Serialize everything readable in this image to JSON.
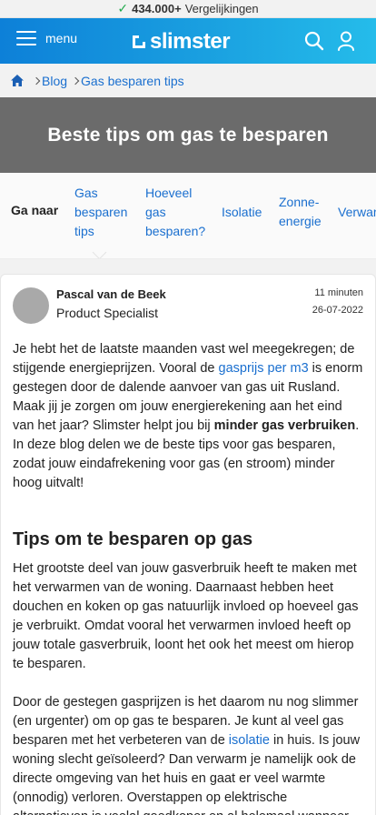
{
  "topbar": {
    "count": "434.000+",
    "label": "Vergelijkingen",
    "icon": "check-icon"
  },
  "header": {
    "menu_label": "menu",
    "logo_text": "slimster",
    "search_icon": "search-icon",
    "user_icon": "user-icon"
  },
  "breadcrumb": {
    "home_icon": "home-icon",
    "items": [
      "Blog",
      "Gas besparen tips"
    ]
  },
  "hero": {
    "title": "Beste tips om gas te besparen"
  },
  "jumpnav": {
    "label": "Ga naar",
    "items": [
      {
        "line1": "Gas",
        "line2": "besparen",
        "line3": "tips"
      },
      {
        "line1": "Hoeveel",
        "line2": "gas",
        "line3": "besparen?"
      },
      {
        "line1": "Isolatie"
      },
      {
        "line1": "Zonne-",
        "line2": "energie"
      },
      {
        "line1": "Verwarmen"
      }
    ]
  },
  "author": {
    "name": "Pascal van de Beek",
    "role": "Product Specialist",
    "read_time": "11 minuten",
    "date": "26-07-2022"
  },
  "intro": {
    "t1": "Je hebt het de laatste maanden vast wel meegekregen; de stijgende energieprijzen. Vooral de ",
    "link1": "gasprijs per m3",
    "t2": " is enorm gestegen door de dalende aanvoer van gas uit Rusland. Maak jij je zorgen om jouw energierekening aan het eind van het jaar? Slimster helpt jou bij ",
    "bold1": "minder gas verbruiken",
    "t3": ". In deze blog delen we de beste tips voor gas besparen, zodat jouw eindafrekening voor gas (en stroom) minder hoog uitvalt!"
  },
  "section": {
    "heading": "Tips om te besparen op gas",
    "p1": "Het grootste deel van jouw gasverbruik heeft te maken met het verwarmen van de woning. Daarnaast hebben heet douchen en koken op gas natuurlijk invloed op hoeveel gas je verbruikt. Omdat vooral het verwarmen invloed heeft op jouw totale gasverbruik, loont het ook het meest om hierop te besparen.",
    "p2_a": "Door de gestegen gasprijzen is het daarom nu nog slimmer (en urgenter) om op gas te besparen. Je kunt al veel gas besparen met het verbeteren van de ",
    "p2_link": "isolatie",
    "p2_b": " in huis. Is jouw woning slecht geïsoleerd? Dan verwarm je namelijk ook de directe omgeving van het huis en gaat er veel warmte (onnodig) verloren. Overstappen op elektrische alternatieven is veelal goedkoper en al helemaal wanneer"
  }
}
